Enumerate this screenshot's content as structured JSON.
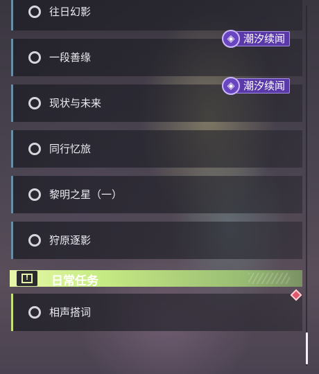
{
  "quests": [
    {
      "label": "往日幻影",
      "tag": null
    },
    {
      "label": "一段善缘",
      "tag": "潮汐续闻"
    },
    {
      "label": "现状与未来",
      "tag": "潮汐续闻"
    },
    {
      "label": "同行忆旅",
      "tag": null
    },
    {
      "label": "黎明之星（一）",
      "tag": null
    },
    {
      "label": "狩原逐影",
      "tag": null
    }
  ],
  "daily_section": {
    "title": "日常任务",
    "badge_icon": "exclamation-icon",
    "accent_color": "#c8ec84",
    "items": [
      {
        "label": "相声搭词",
        "marker": "red-diamond-icon"
      }
    ]
  },
  "colors": {
    "quest_border": "#6a8ea8",
    "daily_border": "#c8e07a",
    "tag_purple": "#5a3aa8",
    "alert_red": "#e0566a"
  }
}
